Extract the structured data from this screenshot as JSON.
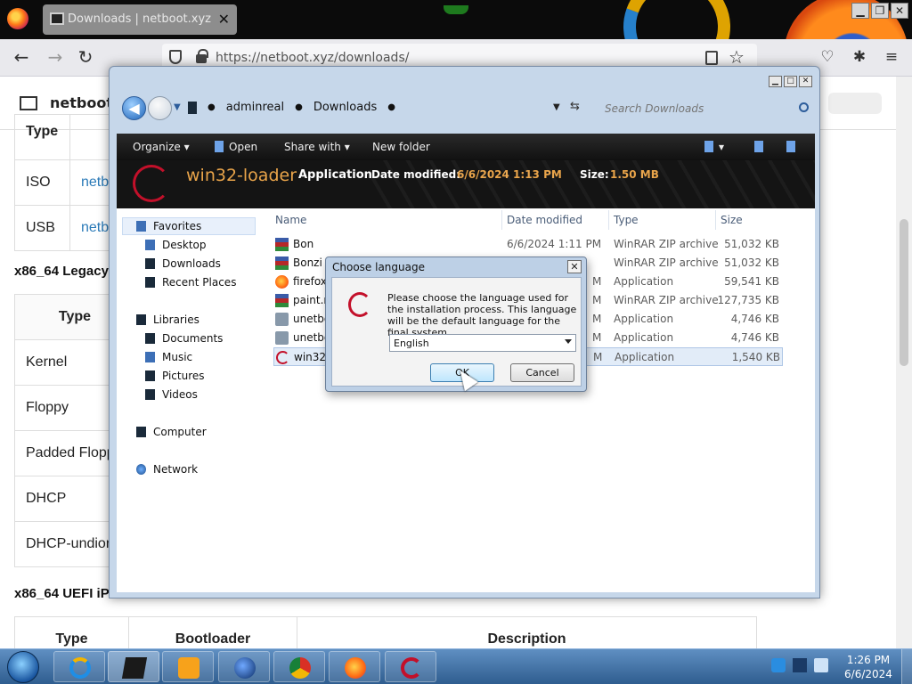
{
  "browser": {
    "tab_title": "Downloads | netboot.xyz",
    "url": "https://netboot.xyz/downloads/"
  },
  "webpage": {
    "site_name": "netboot.",
    "table1": {
      "header": "Type",
      "rows": [
        {
          "type": "ISO",
          "link": "netb"
        },
        {
          "type": "USB",
          "link": "netb"
        }
      ]
    },
    "section2_title": "x86_64 Legacy",
    "table2": {
      "header": "Type",
      "rows": [
        "Kernel",
        "Floppy",
        "Padded Flopp",
        "DHCP",
        "DHCP-undior"
      ]
    },
    "section3_title": "x86_64 UEFI iP",
    "table3": {
      "headers": [
        "Type",
        "Bootloader",
        "Description"
      ]
    }
  },
  "explorer": {
    "breadcrumb": [
      "adminreal",
      "Downloads"
    ],
    "search_placeholder": "Search Downloads",
    "commands": {
      "organize": "Organize",
      "open": "Open",
      "share_with": "Share with",
      "new_folder": "New folder"
    },
    "details": {
      "name": "win32-loader",
      "type": "Application",
      "modified_label": "Date modified:",
      "modified_value": "6/6/2024 1:13 PM",
      "size_label": "Size:",
      "size_value": "1.50 MB"
    },
    "nav": {
      "favorites": "Favorites",
      "desktop": "Desktop",
      "downloads": "Downloads",
      "recent": "Recent Places",
      "libraries": "Libraries",
      "documents": "Documents",
      "music": "Music",
      "pictures": "Pictures",
      "videos": "Videos",
      "computer": "Computer",
      "network": "Network"
    },
    "columns": {
      "name": "Name",
      "date": "Date modified",
      "type": "Type",
      "size": "Size"
    },
    "files": [
      {
        "name": "Bon",
        "date": "6/6/2024 1:11 PM",
        "type": "WinRAR ZIP archive",
        "size": "51,032 KB",
        "icon": "winrar-icon"
      },
      {
        "name": "Bonzi",
        "date": "",
        "type": "WinRAR ZIP archive",
        "size": "51,032 KB",
        "icon": "winrar-icon"
      },
      {
        "name": "firefox-",
        "date": "M",
        "type": "Application",
        "size": "59,541 KB",
        "icon": "firefox-icon"
      },
      {
        "name": "paint.n",
        "date": "M",
        "type": "WinRAR ZIP archive",
        "size": "127,735 KB",
        "icon": "winrar-icon"
      },
      {
        "name": "unetbo",
        "date": "M",
        "type": "Application",
        "size": "4,746 KB",
        "icon": "app-icon"
      },
      {
        "name": "unetbo",
        "date": "M",
        "type": "Application",
        "size": "4,746 KB",
        "icon": "app-icon"
      },
      {
        "name": "win32-",
        "date": "M",
        "type": "Application",
        "size": "1,540 KB",
        "icon": "debian-icon"
      }
    ]
  },
  "dialog": {
    "title": "Choose language",
    "message": "Please choose the language used for the installation process. This language will be the default language for the final system.",
    "selected_language": "English",
    "ok_label": "OK",
    "cancel_label": "Cancel"
  },
  "taskbar": {
    "time": "1:26 PM",
    "date": "6/6/2024"
  },
  "colors": {
    "accent_orange": "#e9a44a",
    "debian_red": "#c3102a",
    "link_blue": "#2a7ab8",
    "taskbar_blue": "#2f5d8f"
  }
}
